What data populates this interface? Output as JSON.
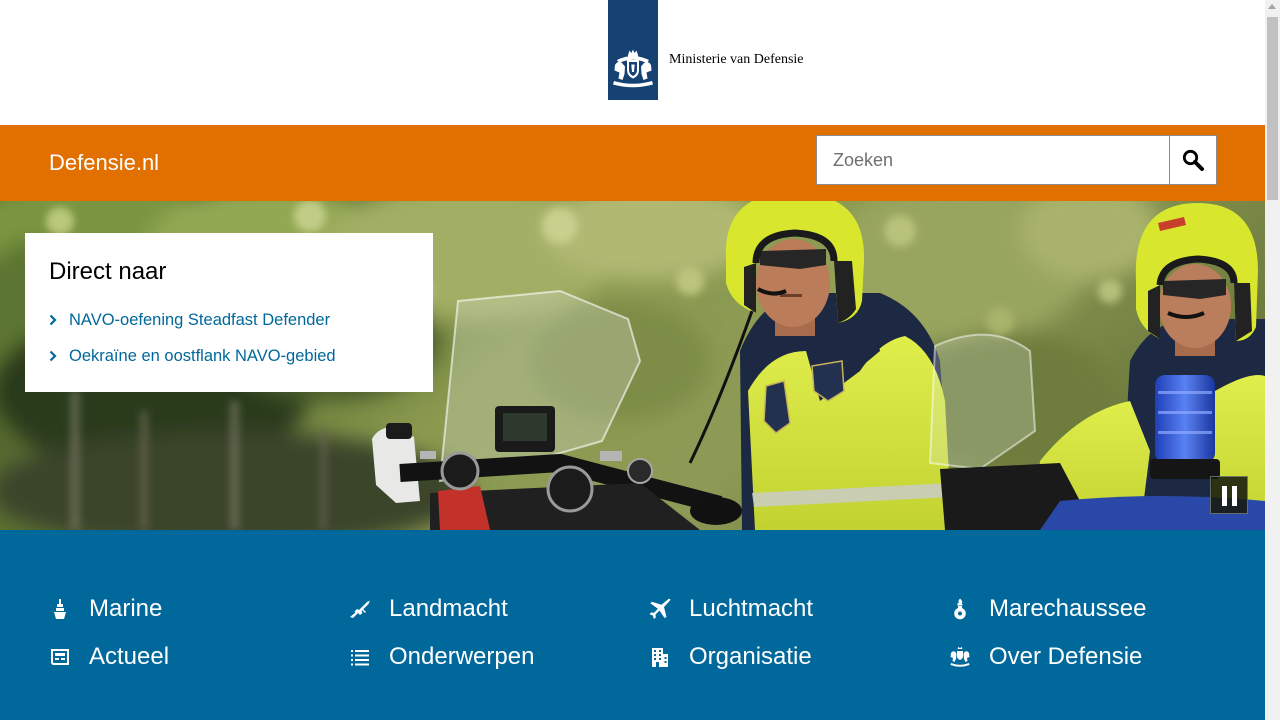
{
  "colors": {
    "orange": "#e17000",
    "blue": "#01689b",
    "logo_blue": "#154273",
    "link": "#01689b"
  },
  "header": {
    "logo_icon": "rijksoverheid-crest-icon",
    "ministry_name": "Ministerie van Defensie"
  },
  "topbar": {
    "site_title": "Defensie.nl",
    "search": {
      "placeholder": "Zoeken",
      "value": "",
      "button_icon": "search-icon"
    }
  },
  "hero": {
    "pause_button_icon": "pause-icon",
    "direct_naar": {
      "title": "Direct naar",
      "links": [
        {
          "label": "NAVO-oefening Steadfast Defender",
          "icon": "chevron-right-icon"
        },
        {
          "label": "Oekraïne en oostflank NAVO-gebied",
          "icon": "chevron-right-icon"
        }
      ]
    }
  },
  "main_nav": {
    "items": [
      {
        "label": "Marine",
        "icon": "ship-icon"
      },
      {
        "label": "Landmacht",
        "icon": "rifle-icon"
      },
      {
        "label": "Luchtmacht",
        "icon": "fighter-jet-icon"
      },
      {
        "label": "Marechaussee",
        "icon": "grenade-icon"
      },
      {
        "label": "Actueel",
        "icon": "newspaper-icon"
      },
      {
        "label": "Onderwerpen",
        "icon": "list-icon"
      },
      {
        "label": "Organisatie",
        "icon": "building-icon"
      },
      {
        "label": "Over Defensie",
        "icon": "crest-icon"
      }
    ]
  }
}
